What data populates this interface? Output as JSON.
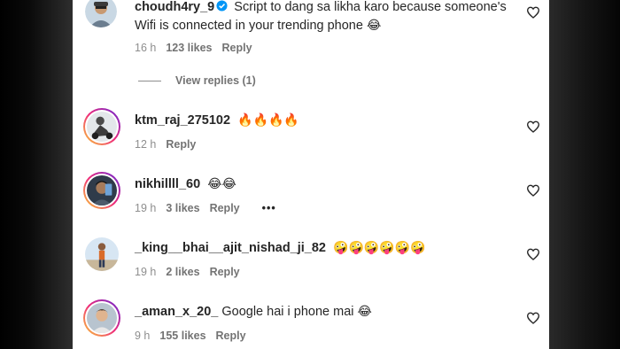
{
  "comments": [
    {
      "username": "choudh4ry_9",
      "verified": true,
      "text": "Script to dang sa likha karo because someone's Wifi is connected in your trending phone",
      "emojis": "😂",
      "time": "16 h",
      "likes": "123 likes",
      "reply": "Reply"
    },
    {
      "username": "ktm_raj_275102",
      "text": "",
      "emojis": "🔥🔥🔥🔥",
      "time": "12 h",
      "likes": "",
      "reply": "Reply"
    },
    {
      "username": "nikhillll_60",
      "text": "",
      "emojis": "😂😂",
      "time": "19 h",
      "likes": "3 likes",
      "reply": "Reply",
      "more": "•••"
    },
    {
      "username": "_king__bhai__ajit_nishad_ji_82",
      "text": "",
      "emojis": "🤪🤪🤪🤪🤪🤪",
      "time": "19 h",
      "likes": "2 likes",
      "reply": "Reply"
    },
    {
      "username": "_aman_x_20_",
      "text": "Google hai i phone mai",
      "emojis": "😂",
      "time": "9 h",
      "likes": "155 likes",
      "reply": "Reply"
    }
  ],
  "view_replies": "View replies (1)",
  "icons": {
    "like": "heart-outline-icon",
    "verified": "verified-badge-icon",
    "more": "more-options-icon"
  },
  "colors": {
    "verified": "#0095f6",
    "text": "#262626",
    "meta": "#8e8e8e"
  }
}
